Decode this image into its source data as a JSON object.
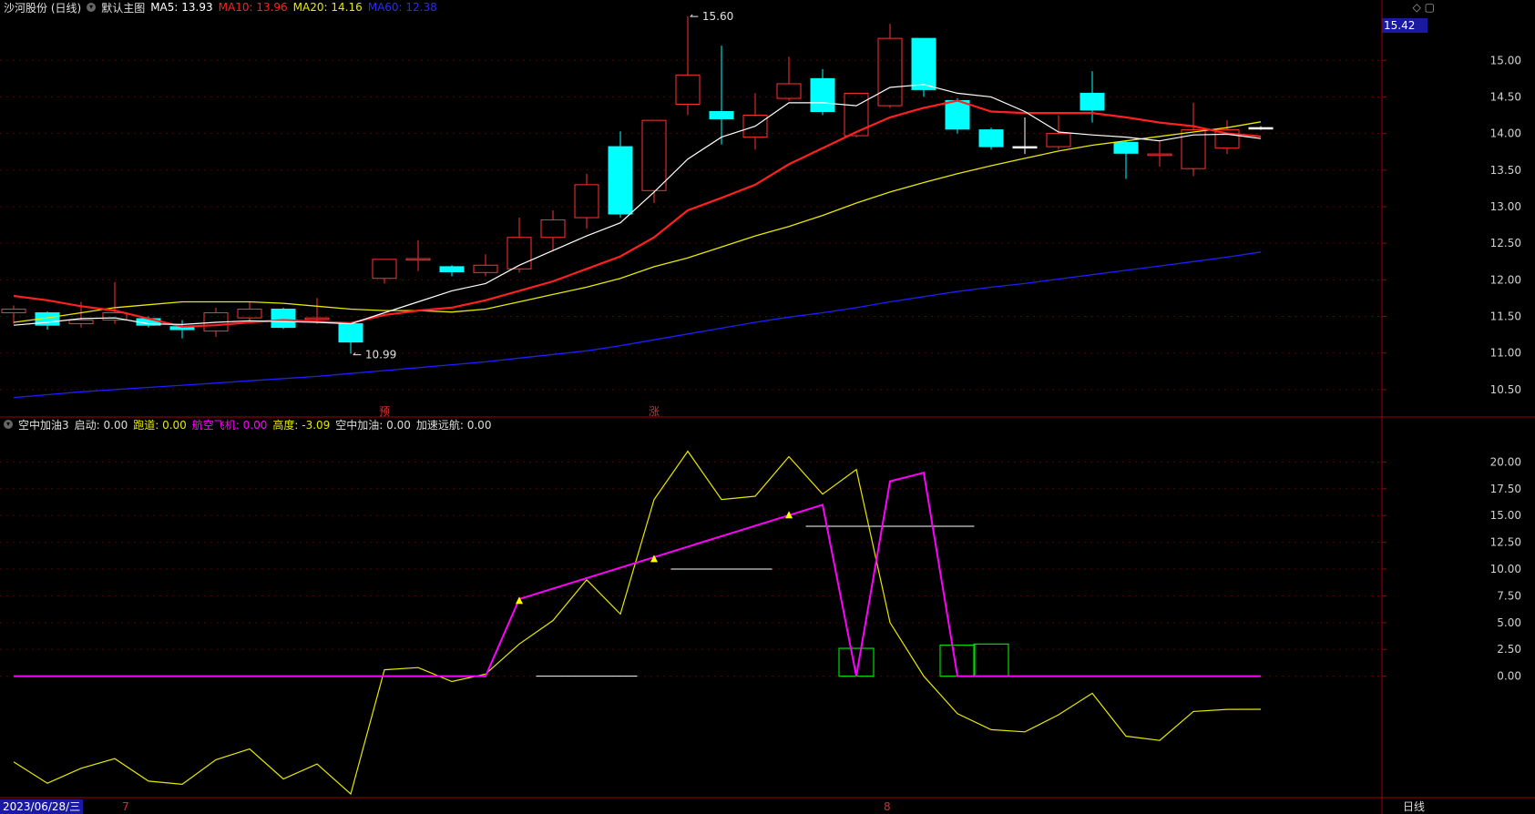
{
  "header": {
    "stock": "沙河股份 (日线)",
    "main_chart_name": "默认主图",
    "ma5": "MA5: 13.93",
    "ma10": "MA10: 13.96",
    "ma20": "MA20: 14.16",
    "ma60": "MA60: 12.38"
  },
  "indicator_header": {
    "name": "空中加油3",
    "items": [
      {
        "text": "启动: 0.00",
        "color": "#dddddd"
      },
      {
        "text": "跑道: 0.00",
        "color": "#e8e800"
      },
      {
        "text": "航空飞机: 0.00",
        "color": "#ff00ff"
      },
      {
        "text": "高度: -3.09",
        "color": "#e8e800"
      },
      {
        "text": "空中加油: 0.00",
        "color": "#dddddd"
      },
      {
        "text": "加速远航: 0.00",
        "color": "#dddddd"
      }
    ]
  },
  "footer": {
    "date": "2023/06/28/三",
    "period": "日线",
    "month_marks": [
      "7",
      "8"
    ]
  },
  "current_price": "15.42",
  "colors": {
    "up": "#ff3232",
    "down": "#00ffff",
    "ma5": "#ffffff",
    "ma10": "#ff2020",
    "ma20": "#e8e800",
    "ma60": "#1e1eff",
    "line_yellow": "#e8e800",
    "line_magenta": "#ff00ff"
  },
  "chart_data": [
    {
      "type": "candlestick",
      "ylim": [
        10.2,
        15.7
      ],
      "yticks": [
        10.5,
        11.0,
        11.5,
        12.0,
        12.5,
        13.0,
        13.5,
        14.0,
        14.5,
        15.0
      ],
      "annotations": {
        "high": "15.60",
        "low": "10.99"
      },
      "signals": [
        "预",
        "涨"
      ],
      "candles": [
        {
          "o": 11.55,
          "c": 11.6,
          "h": 11.65,
          "l": 11.4
        },
        {
          "o": 11.55,
          "c": 11.38,
          "h": 11.57,
          "l": 11.32
        },
        {
          "o": 11.4,
          "c": 11.45,
          "h": 11.7,
          "l": 11.35
        },
        {
          "o": 11.45,
          "c": 11.55,
          "h": 11.97,
          "l": 11.4
        },
        {
          "o": 11.47,
          "c": 11.38,
          "h": 11.5,
          "l": 11.35
        },
        {
          "o": 11.36,
          "c": 11.32,
          "h": 11.45,
          "l": 11.2
        },
        {
          "o": 11.3,
          "c": 11.55,
          "h": 11.62,
          "l": 11.22
        },
        {
          "o": 11.48,
          "c": 11.6,
          "h": 11.7,
          "l": 11.42
        },
        {
          "o": 11.6,
          "c": 11.35,
          "h": 11.62,
          "l": 11.33
        },
        {
          "o": 11.46,
          "c": 11.48,
          "h": 11.75,
          "l": 11.4
        },
        {
          "o": 11.4,
          "c": 11.15,
          "h": 11.42,
          "l": 10.99
        },
        {
          "o": 12.02,
          "c": 12.28,
          "h": 12.28,
          "l": 11.95
        },
        {
          "o": 12.27,
          "c": 12.29,
          "h": 12.54,
          "l": 12.12
        },
        {
          "o": 12.18,
          "c": 12.11,
          "h": 12.2,
          "l": 12.05
        },
        {
          "o": 12.1,
          "c": 12.2,
          "h": 12.35,
          "l": 12.05
        },
        {
          "o": 12.15,
          "c": 12.58,
          "h": 12.85,
          "l": 12.1
        },
        {
          "o": 12.58,
          "c": 12.82,
          "h": 12.95,
          "l": 12.4
        },
        {
          "o": 12.85,
          "c": 13.3,
          "h": 13.45,
          "l": 12.7
        },
        {
          "o": 13.82,
          "c": 12.9,
          "h": 14.03,
          "l": 12.85
        },
        {
          "o": 13.22,
          "c": 14.18,
          "h": 14.18,
          "l": 13.05
        },
        {
          "o": 14.4,
          "c": 14.8,
          "h": 15.6,
          "l": 14.25
        },
        {
          "o": 14.3,
          "c": 14.2,
          "h": 15.2,
          "l": 13.85
        },
        {
          "o": 13.95,
          "c": 14.25,
          "h": 14.55,
          "l": 13.78
        },
        {
          "o": 14.48,
          "c": 14.68,
          "h": 15.05,
          "l": 14.45
        },
        {
          "o": 14.75,
          "c": 14.3,
          "h": 14.88,
          "l": 14.25
        },
        {
          "o": 13.97,
          "c": 14.55,
          "h": 14.55,
          "l": 13.95
        },
        {
          "o": 14.38,
          "c": 15.3,
          "h": 15.5,
          "l": 14.35
        },
        {
          "o": 15.3,
          "c": 14.6,
          "h": 15.3,
          "l": 14.5
        },
        {
          "o": 14.45,
          "c": 14.06,
          "h": 14.48,
          "l": 14.0
        },
        {
          "o": 14.05,
          "c": 13.82,
          "h": 14.08,
          "l": 13.78
        },
        {
          "o": 13.82,
          "c": 13.82,
          "h": 14.22,
          "l": 13.72
        },
        {
          "o": 13.82,
          "c": 14.0,
          "h": 14.25,
          "l": 13.78
        },
        {
          "o": 14.55,
          "c": 14.32,
          "h": 14.85,
          "l": 14.15
        },
        {
          "o": 13.88,
          "c": 13.73,
          "h": 13.9,
          "l": 13.38
        },
        {
          "o": 13.7,
          "c": 13.72,
          "h": 13.9,
          "l": 13.55
        },
        {
          "o": 13.52,
          "c": 14.05,
          "h": 14.42,
          "l": 13.42
        },
        {
          "o": 13.8,
          "c": 14.05,
          "h": 14.18,
          "l": 13.72
        },
        {
          "o": 14.08,
          "c": 14.08,
          "h": 14.1,
          "l": 14.05
        }
      ],
      "ma5": [
        11.38,
        11.42,
        11.47,
        11.48,
        11.4,
        11.39,
        11.42,
        11.44,
        11.43,
        11.42,
        11.4,
        11.55,
        11.7,
        11.85,
        11.95,
        12.2,
        12.4,
        12.6,
        12.78,
        13.2,
        13.65,
        13.95,
        14.1,
        14.42,
        14.42,
        14.38,
        14.63,
        14.67,
        14.55,
        14.5,
        14.3,
        14.02,
        13.98,
        13.95,
        13.9,
        13.98,
        13.99,
        13.93
      ],
      "ma10": [
        11.78,
        11.72,
        11.64,
        11.58,
        11.47,
        11.36,
        11.38,
        11.42,
        11.45,
        11.43,
        11.41,
        11.52,
        11.58,
        11.62,
        11.72,
        11.85,
        11.98,
        12.15,
        12.32,
        12.58,
        12.95,
        13.12,
        13.3,
        13.58,
        13.8,
        14.02,
        14.22,
        14.35,
        14.45,
        14.3,
        14.28,
        14.28,
        14.28,
        14.22,
        14.15,
        14.1,
        14.0,
        13.96
      ],
      "ma20": [
        11.42,
        11.48,
        11.55,
        11.62,
        11.66,
        11.7,
        11.7,
        11.7,
        11.68,
        11.64,
        11.6,
        11.58,
        11.58,
        11.56,
        11.6,
        11.7,
        11.8,
        11.9,
        12.02,
        12.18,
        12.3,
        12.45,
        12.6,
        12.73,
        12.88,
        13.05,
        13.2,
        13.33,
        13.45,
        13.56,
        13.66,
        13.76,
        13.84,
        13.9,
        13.96,
        14.02,
        14.08,
        14.16
      ],
      "ma60": [
        10.39,
        10.43,
        10.47,
        10.5,
        10.53,
        10.56,
        10.59,
        10.62,
        10.65,
        10.68,
        10.72,
        10.76,
        10.8,
        10.84,
        10.88,
        10.93,
        10.98,
        11.03,
        11.1,
        11.18,
        11.26,
        11.34,
        11.42,
        11.49,
        11.55,
        11.62,
        11.7,
        11.77,
        11.84,
        11.9,
        11.95,
        12.01,
        12.07,
        12.13,
        12.19,
        12.25,
        12.31,
        12.38
      ]
    },
    {
      "type": "line",
      "name": "空中加油3",
      "ylim": [
        -11,
        22.5
      ],
      "yticks": [
        0.0,
        2.5,
        5.0,
        7.5,
        10.0,
        12.5,
        15.0,
        17.5,
        20.0
      ],
      "series": [
        {
          "color": "#e8e800",
          "values": [
            -8.0,
            -10.0,
            -8.6,
            -7.7,
            -9.8,
            -10.1,
            -7.8,
            -6.8,
            -9.6,
            -8.2,
            -11.0,
            0.6,
            0.8,
            -0.5,
            0.2,
            3.0,
            5.2,
            9.0,
            5.8,
            16.5,
            21.0,
            16.5,
            16.8,
            20.5,
            17.0,
            19.3,
            5.0,
            0.0,
            -3.5,
            -5.0,
            -5.2,
            -3.6,
            -1.6,
            -5.6,
            -6.0,
            -3.3,
            -3.1,
            -3.09
          ]
        },
        {
          "color": "#ff00ff",
          "values": [
            0,
            0,
            0,
            0,
            0,
            0,
            0,
            0,
            0,
            0,
            0,
            0,
            0,
            0,
            0,
            7.2,
            null,
            null,
            null,
            null,
            null,
            null,
            null,
            null,
            16.0,
            0.0,
            18.2,
            19.0,
            0.0,
            0,
            0,
            0,
            0,
            0,
            0,
            0,
            0,
            0
          ]
        }
      ],
      "triangles": [
        {
          "i": 15,
          "v": 7.0
        },
        {
          "i": 19,
          "v": 10.9
        },
        {
          "i": 23,
          "v": 15.0
        }
      ],
      "white_segments": [
        {
          "from": 15.5,
          "to": 18.5,
          "v": 0.0
        },
        {
          "from": 19.5,
          "to": 22.5,
          "v": 10.0
        },
        {
          "from": 23.5,
          "to": 28.5,
          "v": 14.0
        }
      ],
      "green_boxes": [
        {
          "i": 25,
          "v": 2.6
        },
        {
          "i": 28,
          "v": 2.9
        },
        {
          "i": 29,
          "v": 3.0
        }
      ]
    }
  ]
}
